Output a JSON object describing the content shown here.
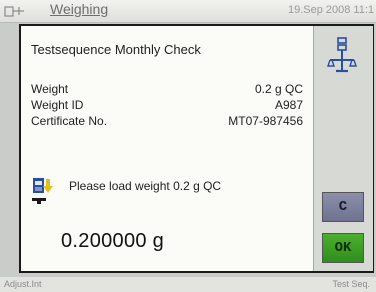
{
  "header": {
    "title": "Weighing",
    "datetime": "19.Sep 2008 11:1",
    "icon": "balance-app-icon"
  },
  "dialog": {
    "title": "Testsequence Monthly Check",
    "fields": [
      {
        "label": "Weight",
        "value": "0.2 g QC"
      },
      {
        "label": "Weight ID",
        "value": "A987"
      },
      {
        "label": "Certificate No.",
        "value": "MT07-987456"
      }
    ],
    "prompt": "Please load weight 0.2 g QC",
    "prompt_icon": "load-weight-icon",
    "readout": "0.200000 g",
    "sidebar_icon": "scale-balance-icon"
  },
  "buttons": {
    "cancel_label": "C",
    "ok_label": "OK"
  },
  "footer": {
    "left": "Adjust.Int",
    "right": "Test Seq."
  },
  "colors": {
    "ok_button": "#3a9d24",
    "cancel_button": "#7d819c",
    "icon_blue": "#2a4fa0",
    "icon_yellow": "#e0c020"
  }
}
